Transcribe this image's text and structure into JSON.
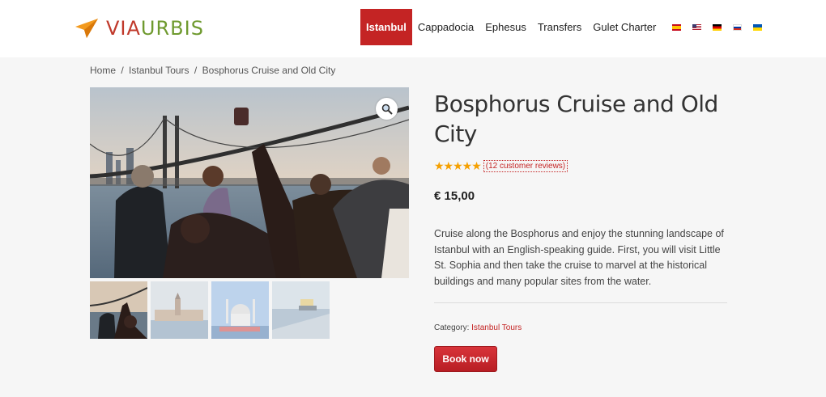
{
  "brand": {
    "part1": "VIA",
    "part2": "URBIS"
  },
  "nav": {
    "items": [
      {
        "label": "Istanbul",
        "active": true
      },
      {
        "label": "Cappadocia",
        "active": false
      },
      {
        "label": "Ephesus",
        "active": false
      },
      {
        "label": "Transfers",
        "active": false
      },
      {
        "label": "Gulet Charter",
        "active": false
      }
    ],
    "flags": [
      "es-flag-icon",
      "us-flag-icon",
      "de-flag-icon",
      "ru-flag-icon",
      "ua-flag-icon"
    ]
  },
  "breadcrumb": {
    "home": "Home",
    "sep": "/",
    "tours": "Istanbul Tours",
    "current": "Bosphorus Cruise and Old City"
  },
  "product": {
    "title": "Bosphorus Cruise and Old City",
    "stars": "★★★★★",
    "reviews": "(12 customer reviews)",
    "price": "€ 15,00",
    "description": "Cruise along the Bosphorus and enjoy the stunning landscape of Istanbul with an English-speaking guide. First, you will visit Little St. Sophia and then take the cruise to marvel at the historical buildings and many popular sites from the water.",
    "category_label": "Category:",
    "category_value": "Istanbul Tours",
    "book_label": "Book now"
  },
  "colors": {
    "accent": "#c42424",
    "star": "#f5a000",
    "logo_green": "#6f9a2f",
    "logo_orange": "#f39a1e"
  }
}
